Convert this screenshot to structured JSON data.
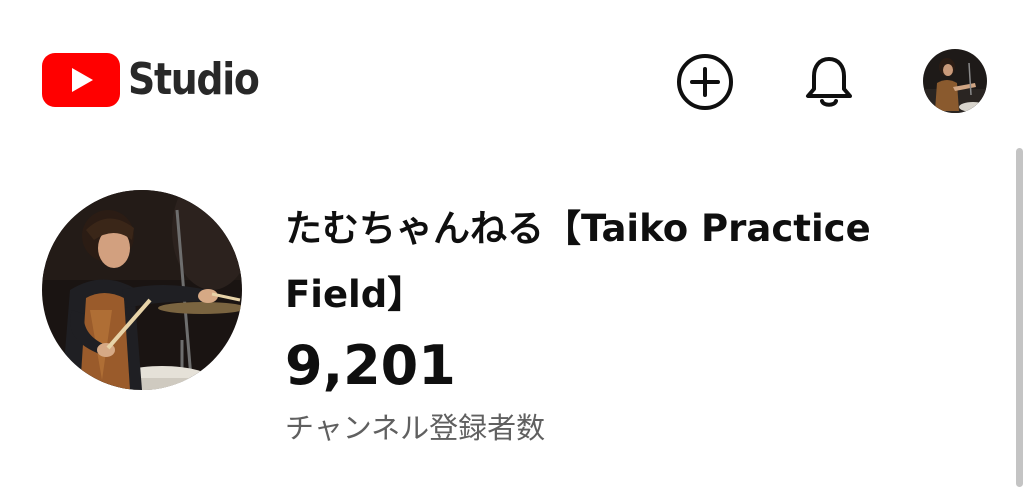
{
  "header": {
    "logo_text": "Studio",
    "brand_color": "#ff0000",
    "actions": {
      "create_icon": "plus-circle-icon",
      "notifications_icon": "bell-icon",
      "account_icon": "avatar"
    }
  },
  "channel": {
    "name": "たむちゃんねる【Taiko Practice Field】",
    "subscriber_count": "9,201",
    "subscriber_label": "チャンネル登録者数"
  },
  "colors": {
    "text_primary": "#0f0f0f",
    "text_secondary": "#606060",
    "scrollbar": "#c4c4c4"
  }
}
